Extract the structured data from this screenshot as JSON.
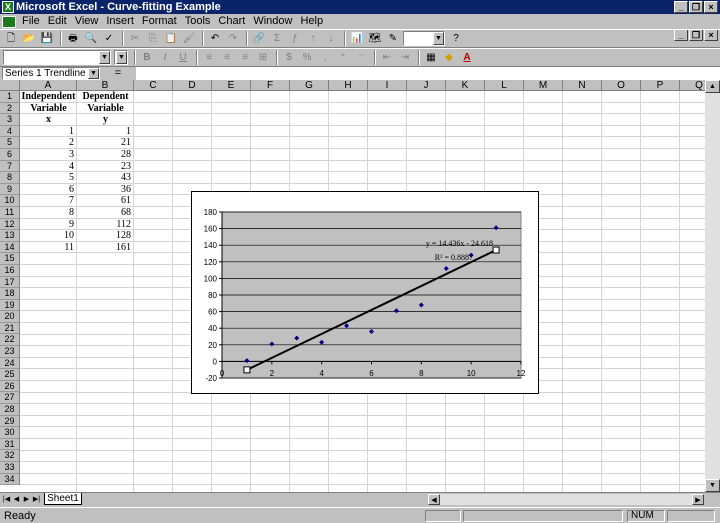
{
  "window": {
    "title": "Microsoft Excel - Curve-fitting Example"
  },
  "menu": [
    "File",
    "Edit",
    "View",
    "Insert",
    "Format",
    "Tools",
    "Chart",
    "Window",
    "Help"
  ],
  "formula_bar": {
    "name_box": "Series 1 Trendline 1",
    "equals": "="
  },
  "columns": [
    "A",
    "B",
    "C",
    "D",
    "E",
    "F",
    "G",
    "H",
    "I",
    "J",
    "K",
    "L",
    "M",
    "N",
    "O",
    "P",
    "Q"
  ],
  "rows": [
    "1",
    "2",
    "3",
    "4",
    "5",
    "6",
    "7",
    "8",
    "9",
    "10",
    "11",
    "12",
    "13",
    "14",
    "15",
    "16",
    "17",
    "18",
    "19",
    "20",
    "21",
    "22",
    "23",
    "24",
    "25",
    "26",
    "27",
    "28",
    "29",
    "30",
    "31",
    "32",
    "33",
    "34"
  ],
  "cells": {
    "A1": "Independent",
    "B1": "Dependent",
    "A2": "Variable",
    "B2": "Variable",
    "A3": "x",
    "B3": "y",
    "data": [
      [
        "1",
        "1"
      ],
      [
        "2",
        "21"
      ],
      [
        "3",
        "28"
      ],
      [
        "4",
        "23"
      ],
      [
        "5",
        "43"
      ],
      [
        "6",
        "36"
      ],
      [
        "7",
        "61"
      ],
      [
        "8",
        "68"
      ],
      [
        "9",
        "112"
      ],
      [
        "10",
        "128"
      ],
      [
        "11",
        "161"
      ]
    ]
  },
  "sheet_tab": "Sheet1",
  "status": {
    "text": "Ready",
    "num": "NUM"
  },
  "chart_data": {
    "type": "scatter",
    "x": [
      1,
      2,
      3,
      4,
      5,
      6,
      7,
      8,
      9,
      10,
      11
    ],
    "y": [
      1,
      21,
      28,
      23,
      43,
      36,
      61,
      68,
      112,
      128,
      161
    ],
    "xlim": [
      0,
      12
    ],
    "ylim": [
      -20,
      180
    ],
    "xticks": [
      "0",
      "2",
      "4",
      "6",
      "8",
      "10",
      "12"
    ],
    "yticks": [
      "-20",
      "0",
      "20",
      "40",
      "60",
      "80",
      "100",
      "120",
      "140",
      "160",
      "180"
    ],
    "trendline": {
      "slope": 14.436,
      "intercept": -24.618,
      "x_range": [
        1,
        11
      ]
    },
    "equation": "y = 14.436x - 24.618",
    "r_squared": "R² = 0.8887",
    "grid": true,
    "plot_background": "#c0c0c0",
    "marker_color": "#000080"
  }
}
